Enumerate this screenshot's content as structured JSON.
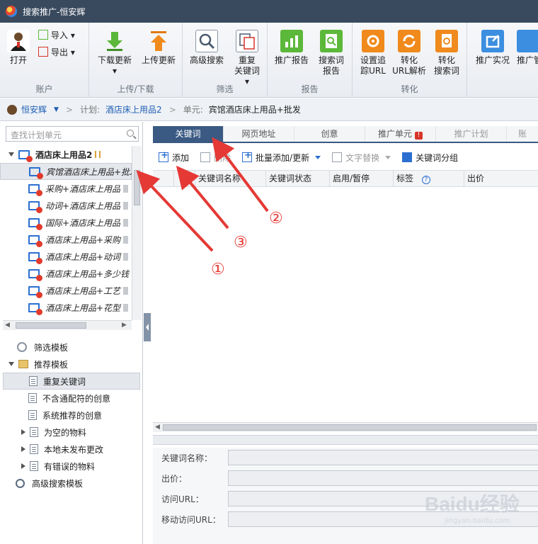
{
  "window": {
    "title": "搜索推广-恒安辉"
  },
  "ribbon": {
    "account": {
      "group": "账户",
      "open": "打开",
      "import": "导入",
      "export": "导出"
    },
    "upload": {
      "group": "上传/下载",
      "download_update": "下载更新",
      "upload_update": "上传更新"
    },
    "filter": {
      "group": "筛选",
      "advanced_search": "高级搜索",
      "dup_kw_1": "重复",
      "dup_kw_2": "关键词"
    },
    "report": {
      "group": "报告",
      "promo_report": "推广报告",
      "search_term_1": "搜索词",
      "search_term_2": "报告"
    },
    "convert": {
      "group": "转化",
      "track_1": "设置追",
      "track_2": "踪URL",
      "url_1": "转化",
      "url_2": "URL解析",
      "term_1": "转化",
      "term_2": "搜索词"
    },
    "more": {
      "live": "推广实况",
      "cut": "推广管"
    }
  },
  "breadcrumb": {
    "user": "恒安辉",
    "plan_label": "计划:",
    "plan": "酒店床上用品2",
    "unit_label": "单元:",
    "unit": "宾馆酒店床上用品+批发"
  },
  "left": {
    "search_placeholder": "查找计划单元",
    "root": "酒店床上用品2",
    "units": [
      "宾馆酒店床上用品+批发",
      "采购+酒店床上用品",
      "动词+酒店床上用品",
      "国际+酒店床上用品",
      "酒店床上用品+采购",
      "酒店床上用品+动词",
      "酒店床上用品+多少钱",
      "酒店床上用品+工艺",
      "酒店床上用品+花型"
    ],
    "filter_template": "筛选模板",
    "recommend_template": "推荐模板",
    "templates": [
      {
        "label": "重复关键词",
        "expandable": false
      },
      {
        "label": "不含通配符的创意",
        "expandable": false
      },
      {
        "label": "系统推荐的创意",
        "expandable": false
      },
      {
        "label": "为空的物料",
        "expandable": true
      },
      {
        "label": "本地未发布更改",
        "expandable": true
      },
      {
        "label": "有错误的物料",
        "expandable": true
      }
    ],
    "advanced_template": "高级搜索模板"
  },
  "tabs": {
    "keyword": "关键词",
    "page_url": "网页地址",
    "creative": "创意",
    "unit": "推广单元",
    "plan": "推广计划",
    "account": "账"
  },
  "toolbar": {
    "add": "添加",
    "delete": "删除",
    "batch": "批量添加/更新",
    "replace": "文字替换",
    "group": "关键词分组"
  },
  "grid": {
    "columns": [
      "",
      "关键词名称",
      "关键词状态",
      "启用/暂停",
      "标签",
      "出价"
    ]
  },
  "detail": {
    "kw_name": "关键词名称：",
    "bid": "出价：",
    "url": "访问URL：",
    "mobile_url": "移动访问URL："
  },
  "annotations": {
    "n1": "①",
    "n2": "②",
    "n3": "③",
    "arrow_color": "#e53935"
  },
  "watermark": {
    "brand": "Baidu经验",
    "site": "jingyan.baidu.com"
  }
}
